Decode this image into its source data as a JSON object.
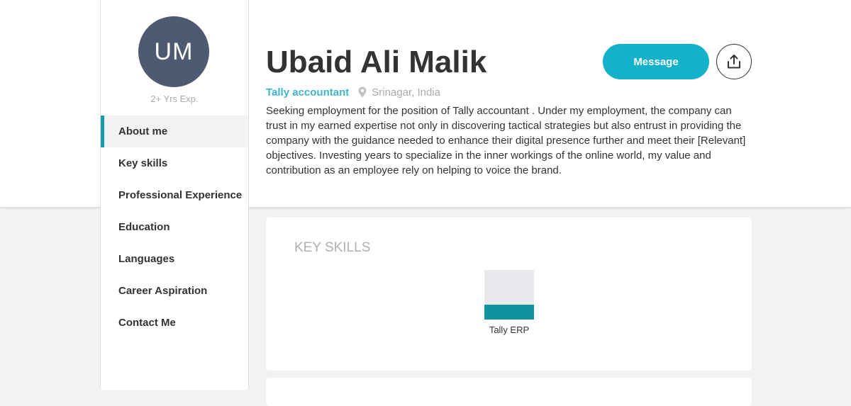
{
  "profile": {
    "initials": "UM",
    "experience": "2+ Yrs Exp.",
    "name": "Ubaid Ali Malik",
    "role": "Tally accountant",
    "location": "Srinagar, India",
    "about": "Seeking employment for the position of Tally accountant . Under my employment, the company can trust in my earned expertise not only in discovering tactical strategies but also entrust in providing the company with the guidance needed to enhance their digital presence further and meet their [Relevant] objectives. Investing years to specialize in the inner workings of the online world, my value and contribution as an employee rely on helping to voice the brand."
  },
  "nav": {
    "items": [
      {
        "label": "About me",
        "active": true
      },
      {
        "label": "Key skills"
      },
      {
        "label": "Professional Experience"
      },
      {
        "label": "Education"
      },
      {
        "label": "Languages"
      },
      {
        "label": "Career Aspiration"
      },
      {
        "label": "Contact Me"
      }
    ]
  },
  "actions": {
    "message_label": "Message",
    "share_icon": "share-icon"
  },
  "key_skills": {
    "title": "KEY SKILLS",
    "skills": [
      {
        "name": "Tally ERP",
        "level": 0.3
      }
    ]
  },
  "colors": {
    "accent": "#14b2ca",
    "role_text": "#3fb6c7",
    "avatar_bg": "#4e5a72",
    "skill_fill": "#11929f",
    "active_marker": "#1a9bad"
  }
}
